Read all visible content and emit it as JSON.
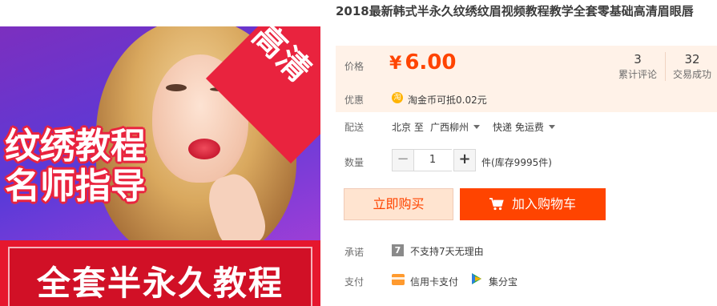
{
  "gallery": {
    "corner_badge": "高清",
    "headline_lines": [
      "纹绣教程",
      "名师指导"
    ],
    "bottom_banner": "全套半永久教程"
  },
  "product": {
    "title": "2018最新韩式半永久纹绣纹眉视频教程教学全套零基础高清眉眼唇"
  },
  "price": {
    "label": "价格",
    "currency": "¥",
    "amount": "6.00",
    "reviews_count": "3",
    "reviews_label": "累计评论",
    "sales_count": "32",
    "sales_label": "交易成功"
  },
  "promo": {
    "label": "优惠",
    "coin_glyph": "淘",
    "text": "淘金币可抵0.02元"
  },
  "shipping": {
    "label": "配送",
    "from": "北京 至",
    "to": "广西柳州",
    "method": "快递 免运费"
  },
  "quantity": {
    "label": "数量",
    "minus": "−",
    "value": "1",
    "plus": "+",
    "stock_text": "件(库存9995件)"
  },
  "actions": {
    "buy_now": "立即购买",
    "add_to_cart": "加入购物车"
  },
  "promise": {
    "label": "承诺",
    "icon_text": "7",
    "text": "不支持7天无理由"
  },
  "payment": {
    "label": "支付",
    "credit_card": "信用卡支付",
    "jifenbao": "集分宝"
  },
  "colors": {
    "accent": "#ff4400",
    "price_bg": "#fff2e8",
    "banner_red": "#e6172e"
  }
}
